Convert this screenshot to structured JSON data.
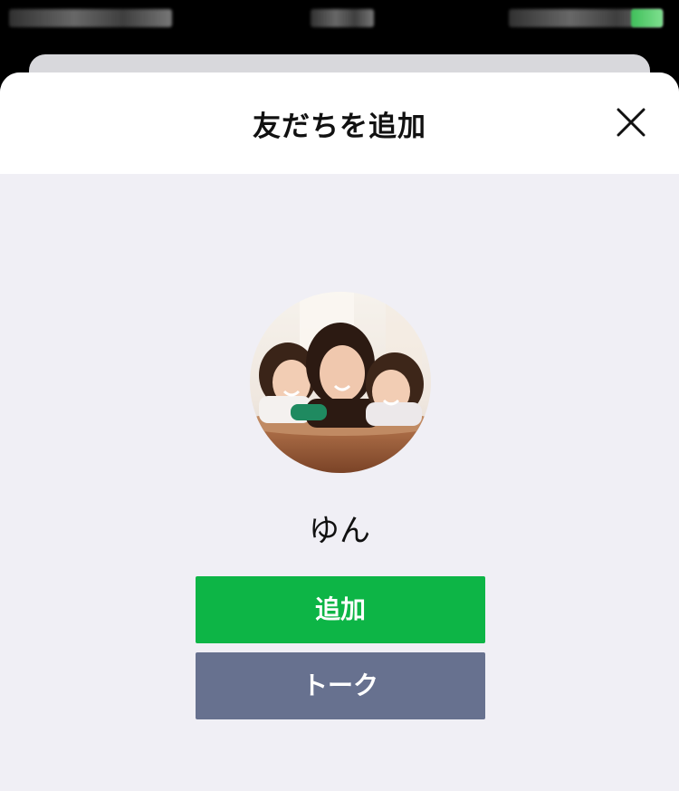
{
  "header": {
    "title": "友だちを追加",
    "close_icon": "close-icon"
  },
  "profile": {
    "name": "ゆん",
    "avatar": "profile-photo"
  },
  "actions": {
    "add_label": "追加",
    "talk_label": "トーク"
  },
  "colors": {
    "add_button": "#0db546",
    "talk_button": "#67718f",
    "sheet_background": "#f0eff5",
    "header_background": "#ffffff"
  }
}
